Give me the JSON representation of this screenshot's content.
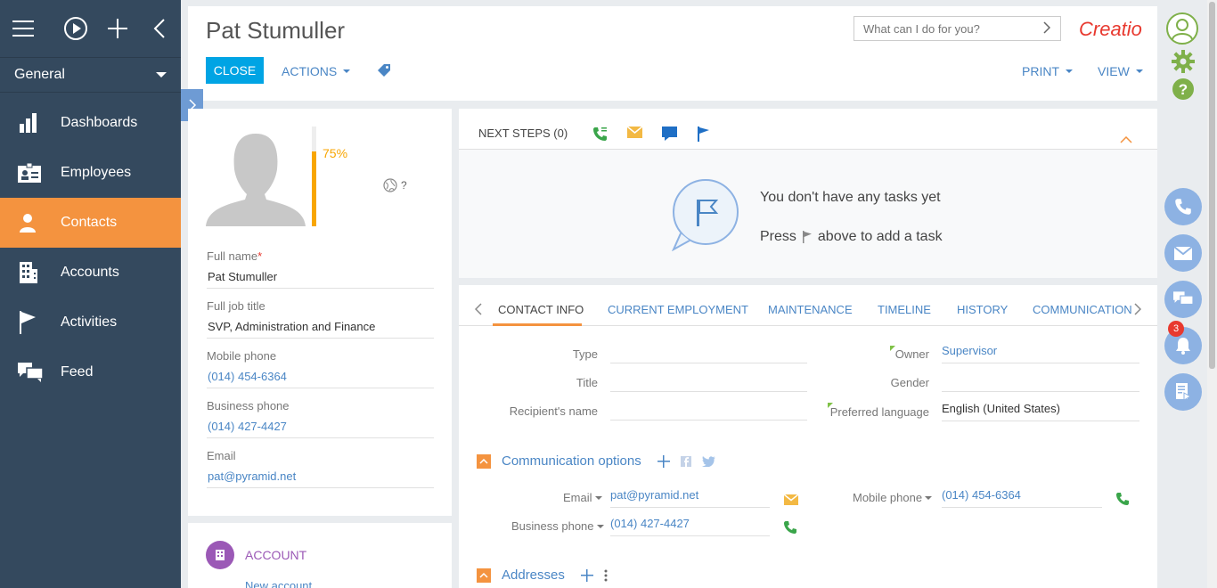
{
  "sidebar": {
    "workplace": "General",
    "items": [
      {
        "label": "Dashboards",
        "icon": "bar-chart-icon"
      },
      {
        "label": "Employees",
        "icon": "id-card-icon"
      },
      {
        "label": "Contacts",
        "icon": "person-icon"
      },
      {
        "label": "Accounts",
        "icon": "building-icon"
      },
      {
        "label": "Activities",
        "icon": "flag-icon"
      },
      {
        "label": "Feed",
        "icon": "chat-bubbles-icon"
      }
    ],
    "active_index": 2
  },
  "header": {
    "title": "Pat Stumuller",
    "close_label": "CLOSE",
    "actions_label": "ACTIONS",
    "print_label": "PRINT",
    "view_label": "VIEW",
    "search_placeholder": "What can I do for you?",
    "logo_text": "Creatio"
  },
  "profile": {
    "completeness_percent": 75,
    "completeness_label": "75%",
    "timezone_label": "?",
    "fields": [
      {
        "label": "Full name",
        "required": true,
        "value": "Pat Stumuller",
        "link": false
      },
      {
        "label": "Full job title",
        "required": false,
        "value": "SVP, Administration and Finance",
        "link": false
      },
      {
        "label": "Mobile phone",
        "required": false,
        "value": "(014) 454-6364",
        "link": true
      },
      {
        "label": "Business phone",
        "required": false,
        "value": "(014) 427-4427",
        "link": true
      },
      {
        "label": "Email",
        "required": false,
        "value": "pat@pyramid.net",
        "link": true
      }
    ]
  },
  "account": {
    "title": "ACCOUNT",
    "new_link": "New account"
  },
  "next_steps": {
    "title": "NEXT STEPS (0)",
    "empty_line1": "You don't have any tasks yet",
    "empty_line2_a": "Press",
    "empty_line2_b": "above to add a task"
  },
  "tabs": {
    "items": [
      "CONTACT INFO",
      "CURRENT EMPLOYMENT",
      "MAINTENANCE",
      "TIMELINE",
      "HISTORY",
      "COMMUNICATION"
    ],
    "active_index": 0
  },
  "contact_info": {
    "type_label": "Type",
    "type_value": "",
    "title_label": "Title",
    "title_value": "",
    "recipient_label": "Recipient's name",
    "recipient_value": "",
    "owner_label": "Owner",
    "owner_value": "Supervisor",
    "gender_label": "Gender",
    "gender_value": "",
    "language_label": "Preferred language",
    "language_value": "English (United States)"
  },
  "communication": {
    "group_title": "Communication options",
    "email_label": "Email",
    "email_value": "pat@pyramid.net",
    "business_label": "Business phone",
    "business_value": "(014) 427-4427",
    "mobile_label": "Mobile phone",
    "mobile_value": "(014) 454-6364"
  },
  "addresses": {
    "group_title": "Addresses"
  },
  "rail": {
    "notification_count": "3"
  },
  "colors": {
    "sidebar_bg": "#34495e",
    "accent_orange": "#f4933f",
    "primary_blue": "#00a4e4",
    "link_blue": "#4a86c5",
    "rail_blue": "#8db2e3"
  }
}
